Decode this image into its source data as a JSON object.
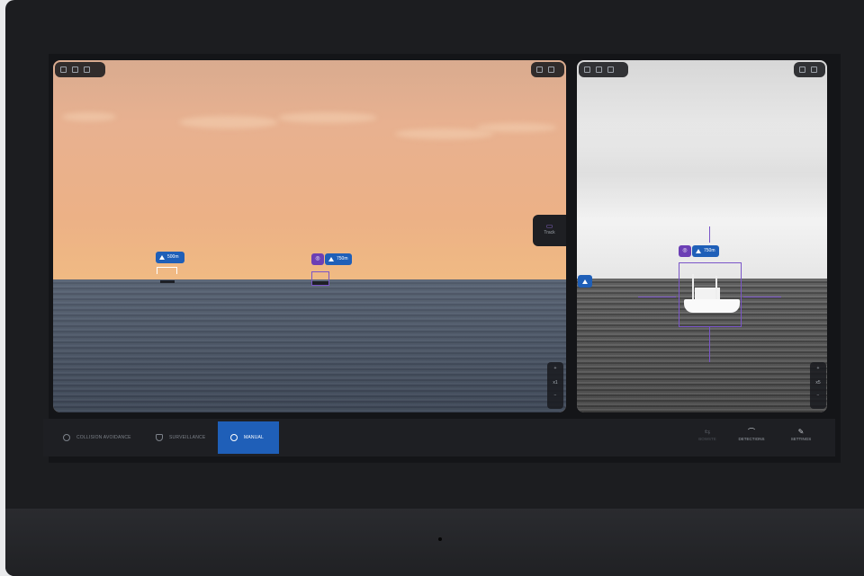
{
  "side_panel": {
    "track_label": "Track"
  },
  "left_camera": {
    "targets": [
      {
        "distance": "500m",
        "tracked": false
      },
      {
        "distance": "750m",
        "tracked": true
      }
    ],
    "zoom_level": "x1"
  },
  "right_camera": {
    "target": {
      "distance": "750m",
      "tracked": true
    },
    "zoom_level": "x5"
  },
  "taskbar": {
    "modes": [
      {
        "label": "COLLISION AVOIDANCE",
        "icon": "compass-icon",
        "active": false
      },
      {
        "label": "SURVEILLANCE",
        "icon": "shield-icon",
        "active": false
      },
      {
        "label": "MANUAL",
        "icon": "steering-wheel-icon",
        "active": true
      }
    ],
    "right_nav": [
      {
        "label": "BOWSTE",
        "icon": "dual-arrow-icon",
        "enabled": false
      },
      {
        "label": "DETECTIONS",
        "icon": "detections-icon",
        "enabled": true
      },
      {
        "label": "SETTINGS",
        "icon": "wrench-icon",
        "enabled": true
      }
    ]
  },
  "colors": {
    "accent_blue": "#1f5fb8",
    "track_purple": "#6c3fb5",
    "bezel": "#1c1d20"
  }
}
